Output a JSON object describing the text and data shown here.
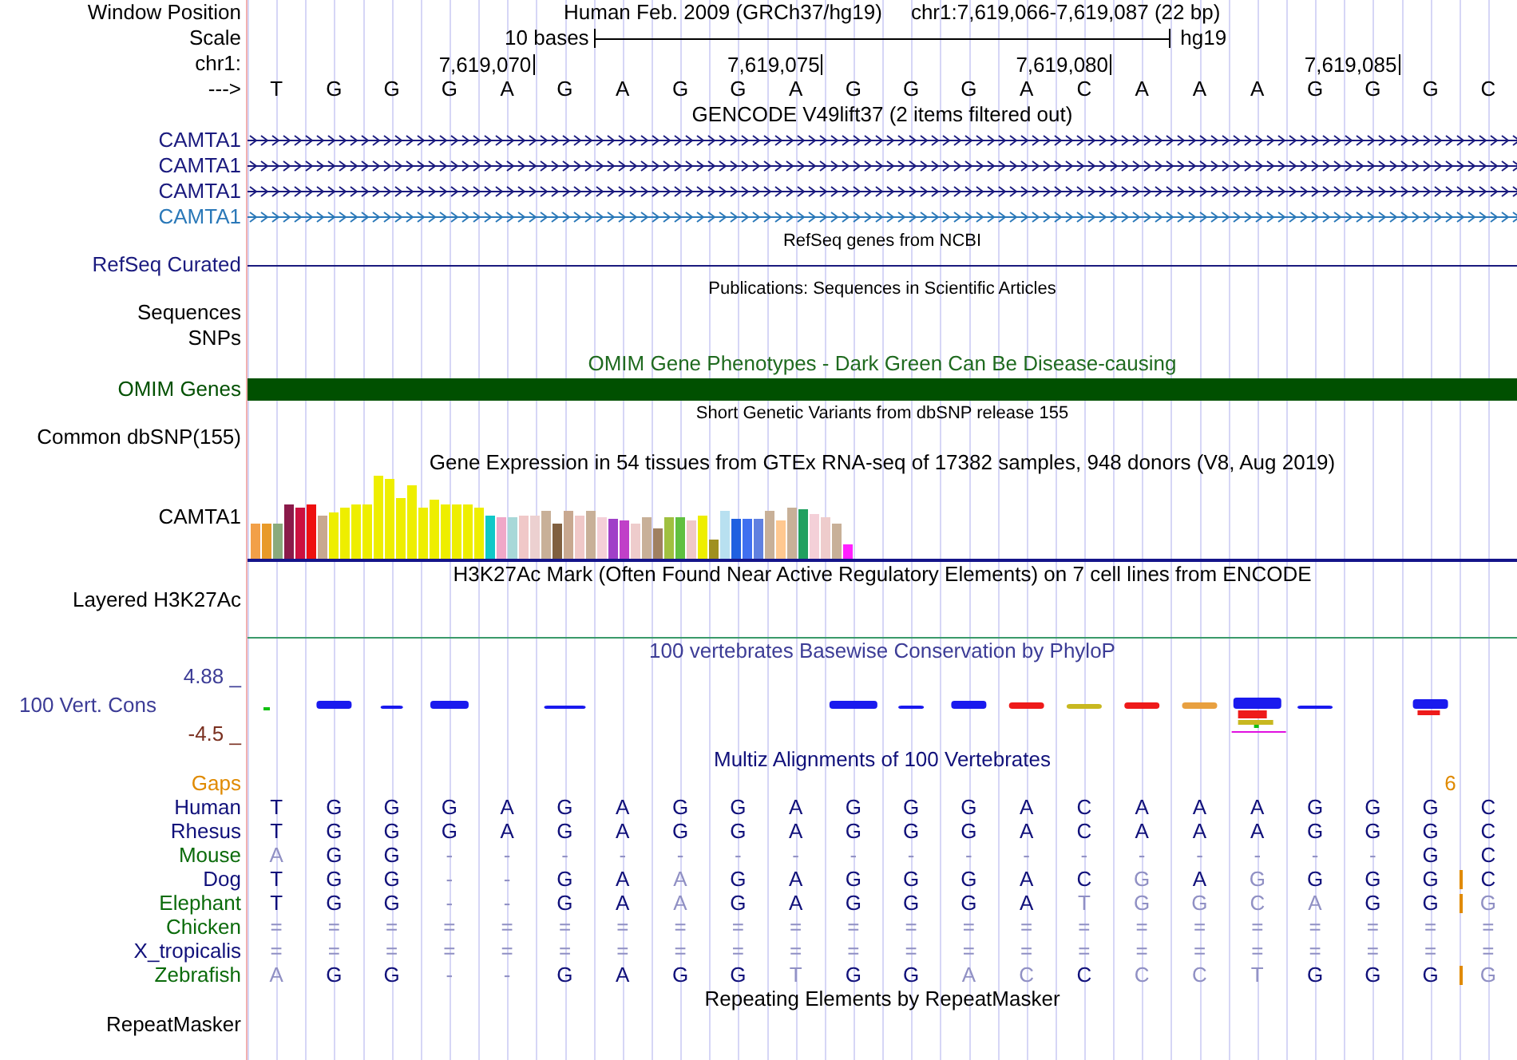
{
  "header": {
    "label": "Window Position",
    "assembly": "Human Feb. 2009 (GRCh37/hg19)",
    "position": "chr1:7,619,066-7,619,087 (22 bp)"
  },
  "scale": {
    "label": "Scale",
    "length": "10 bases",
    "assembly": "hg19"
  },
  "ruler": {
    "label": "chr1:",
    "ticks": [
      "7,619,070",
      "7,619,075",
      "7,619,080",
      "7,619,085"
    ]
  },
  "sequence": {
    "label": "--->",
    "bases": [
      "T",
      "G",
      "G",
      "G",
      "A",
      "G",
      "A",
      "G",
      "G",
      "A",
      "G",
      "G",
      "G",
      "A",
      "C",
      "A",
      "A",
      "A",
      "G",
      "G",
      "G",
      "C"
    ]
  },
  "tracks": [
    {
      "kind": "gene",
      "title": "GENCODE V49lift37 (2 items filtered out)",
      "small_title": false,
      "items": [
        {
          "name": "CAMTA1",
          "color": "#1a1a7e"
        },
        {
          "name": "CAMTA1",
          "color": "#1a1a7e"
        },
        {
          "name": "CAMTA1",
          "color": "#1a1a7e"
        },
        {
          "name": "CAMTA1",
          "color": "#2a78b8"
        }
      ]
    },
    {
      "kind": "line",
      "title": "RefSeq genes from NCBI",
      "small_title": true,
      "label": "RefSeq Curated",
      "color": "#1a1a7e"
    },
    {
      "kind": "labels",
      "title": "Publications: Sequences in Scientific Articles",
      "small_title": true,
      "labels": [
        "Sequences",
        "SNPs"
      ]
    },
    {
      "kind": "bar",
      "title": "OMIM Gene Phenotypes - Dark Green Can Be Disease-causing",
      "small_title": false,
      "label": "OMIM Genes",
      "color": "#005000"
    },
    {
      "kind": "labels",
      "title": "Short Genetic Variants from dbSNP release 155",
      "small_title": true,
      "labels": [
        "Common dbSNP(155)"
      ]
    },
    {
      "kind": "expression",
      "title": "Gene Expression in 54 tissues from GTEx RNA-seq of 17382 samples, 948 donors (V8, Aug 2019)",
      "small_title": false,
      "label": "CAMTA1"
    },
    {
      "kind": "signal",
      "title": "H3K27Ac Mark (Often Found Near Active Regulatory Elements) on 7 cell lines from ENCODE",
      "small_title": false,
      "label": "Layered H3K27Ac"
    },
    {
      "kind": "conservation",
      "title": "100 vertebrates Basewise Conservation by PhyloP",
      "small_title": false,
      "label": "100 Vert. Cons",
      "max": "4.88 _",
      "min": "-4.5 _"
    },
    {
      "kind": "alignment",
      "title": "Multiz Alignments of 100 Vertebrates",
      "small_title": false,
      "gaps": {
        "label": "Gaps",
        "count": "6"
      },
      "species": [
        {
          "name": "Human",
          "color": "#10107a",
          "insertion": false,
          "bases": [
            "T",
            "G",
            "G",
            "G",
            "A",
            "G",
            "A",
            "G",
            "G",
            "A",
            "G",
            "G",
            "G",
            "A",
            "C",
            "A",
            "A",
            "A",
            "G",
            "G",
            "G",
            "C"
          ]
        },
        {
          "name": "Rhesus",
          "color": "#10107a",
          "insertion": false,
          "bases": [
            "T",
            "G",
            "G",
            "G",
            "A",
            "G",
            "A",
            "G",
            "G",
            "A",
            "G",
            "G",
            "G",
            "A",
            "C",
            "A",
            "A",
            "A",
            "G",
            "G",
            "G",
            "C"
          ]
        },
        {
          "name": "Mouse",
          "color": "#0b6b0b",
          "insertion": false,
          "bases": [
            "A",
            "G",
            "G",
            "-",
            "-",
            "-",
            "-",
            "-",
            "-",
            "-",
            "-",
            "-",
            "-",
            "-",
            "-",
            "-",
            "-",
            "-",
            "-",
            "-",
            "G",
            "C"
          ]
        },
        {
          "name": "Dog",
          "color": "#10107a",
          "insertion": true,
          "bases": [
            "T",
            "G",
            "G",
            "-",
            "-",
            "G",
            "A",
            "A",
            "G",
            "A",
            "G",
            "G",
            "G",
            "A",
            "C",
            "G",
            "A",
            "G",
            "G",
            "G",
            "G",
            "C"
          ]
        },
        {
          "name": "Elephant",
          "color": "#0b6b0b",
          "insertion": true,
          "bases": [
            "T",
            "G",
            "G",
            "-",
            "-",
            "G",
            "A",
            "A",
            "G",
            "A",
            "G",
            "G",
            "G",
            "A",
            "T",
            "G",
            "G",
            "C",
            "A",
            "G",
            "G",
            "G"
          ]
        },
        {
          "name": "Chicken",
          "color": "#0b6b0b",
          "insertion": false,
          "bases": [
            "=",
            "=",
            "=",
            "=",
            "=",
            "=",
            "=",
            "=",
            "=",
            "=",
            "=",
            "=",
            "=",
            "=",
            "=",
            "=",
            "=",
            "=",
            "=",
            "=",
            "=",
            "="
          ]
        },
        {
          "name": "X_tropicalis",
          "color": "#10107a",
          "insertion": false,
          "bases": [
            "=",
            "=",
            "=",
            "=",
            "=",
            "=",
            "=",
            "=",
            "=",
            "=",
            "=",
            "=",
            "=",
            "=",
            "=",
            "=",
            "=",
            "=",
            "=",
            "=",
            "=",
            "="
          ]
        },
        {
          "name": "Zebrafish",
          "color": "#0b6b0b",
          "insertion": true,
          "bases": [
            "A",
            "G",
            "G",
            "-",
            "-",
            "G",
            "A",
            "G",
            "G",
            "T",
            "G",
            "G",
            "A",
            "C",
            "C",
            "C",
            "C",
            "T",
            "G",
            "G",
            "G",
            "G"
          ]
        }
      ]
    },
    {
      "kind": "labels",
      "title": "Repeating Elements by RepeatMasker",
      "small_title": false,
      "labels": [
        "RepeatMasker"
      ]
    }
  ]
}
